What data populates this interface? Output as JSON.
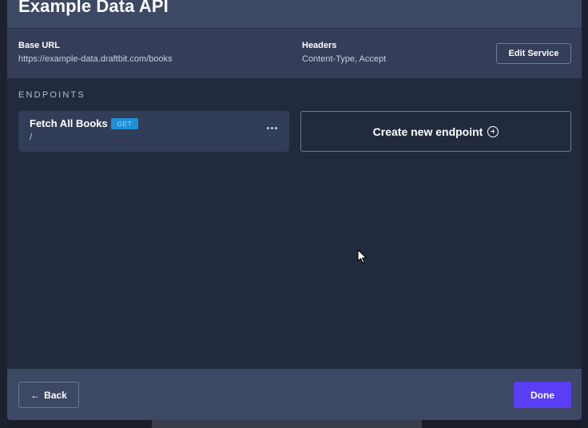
{
  "modal": {
    "title": "Example Data API",
    "base_url": {
      "label": "Base URL",
      "value": "https://example-data.draftbit.com/books"
    },
    "headers": {
      "label": "Headers",
      "value": "Content-Type, Accept"
    },
    "edit_service_label": "Edit Service",
    "endpoints_section_title": "ENDPOINTS",
    "endpoints": [
      {
        "name": "Fetch All Books",
        "method": "GET",
        "path": "/"
      }
    ],
    "create_endpoint_label": "Create new endpoint",
    "create_endpoint_icon": "plus-circle-icon",
    "footer": {
      "back_label": "Back",
      "back_icon": "arrow-left-icon",
      "done_label": "Done"
    },
    "colors": {
      "accent": "#5a3ef5",
      "method_badge": "#1e90d6",
      "header_bg": "#3d4864",
      "body_bg": "#222a3d"
    }
  }
}
